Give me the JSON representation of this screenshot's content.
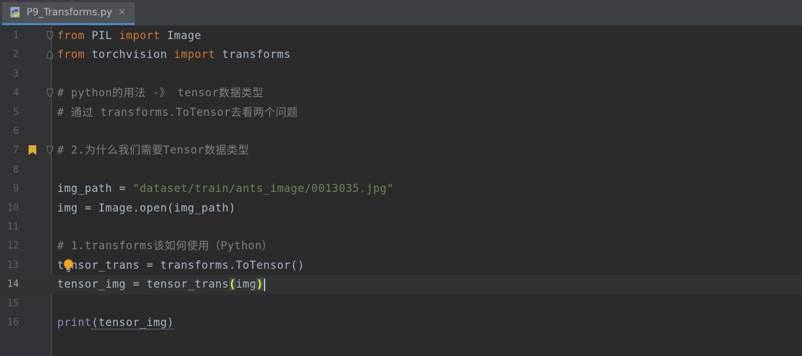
{
  "tab": {
    "label": "P9_Transforms.py",
    "close": "✕",
    "icon": "python-file-icon"
  },
  "lines": [
    {
      "n": "1",
      "parts": [
        [
          "kw",
          "from"
        ],
        [
          "",
          "PIL"
        ],
        [
          "kw",
          "import"
        ],
        [
          "",
          "Image"
        ]
      ]
    },
    {
      "n": "2",
      "parts": [
        [
          "kw",
          "from"
        ],
        [
          "",
          "torchvision"
        ],
        [
          "kw",
          "import"
        ],
        [
          "",
          "transforms"
        ]
      ]
    },
    {
      "n": "3",
      "parts": []
    },
    {
      "n": "4",
      "text": "# python的用法 -》 tensor数据类型"
    },
    {
      "n": "5",
      "text": "# 通过 transforms.ToTensor去看两个问题"
    },
    {
      "n": "6",
      "parts": []
    },
    {
      "n": "7",
      "text": "# 2.为什么我们需要Tensor数据类型"
    },
    {
      "n": "8",
      "parts": []
    },
    {
      "n": "9",
      "var": "img_path = ",
      "str": "\"dataset/train/ants_image/0013035.jpg\""
    },
    {
      "n": "10",
      "text": "img = Image.open(img_path)"
    },
    {
      "n": "11",
      "parts": []
    },
    {
      "n": "12",
      "text": "# 1.transforms该如何使用（Python）"
    },
    {
      "n": "13",
      "text": "tensor_trans = transforms.ToTensor()"
    },
    {
      "n": "14",
      "pre": "tensor_img = tensor_trans",
      "open": "(",
      "mid": "img",
      "close": ")"
    },
    {
      "n": "15",
      "parts": []
    },
    {
      "n": "16",
      "fn": "print",
      "rest": "(tensor_img)"
    }
  ],
  "colors": {
    "keyword": "#cc7832",
    "string": "#6a8759",
    "comment": "#808080",
    "builtin": "#8888c6",
    "text": "#a9b7c6"
  }
}
